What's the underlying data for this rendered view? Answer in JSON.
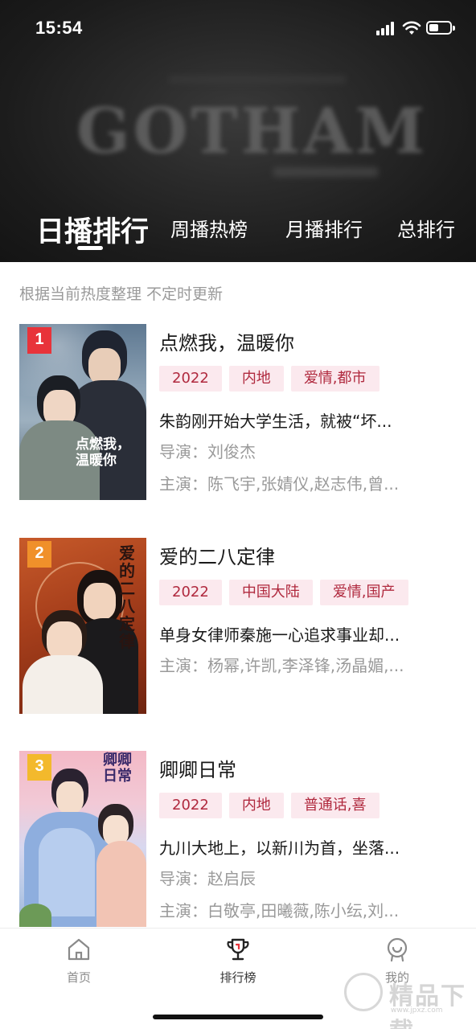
{
  "status_bar": {
    "time": "15:54",
    "battery_percent": 45
  },
  "header": {
    "backdrop_text": "GOTHAM",
    "tabs": [
      {
        "label": "日播排行",
        "active": true
      },
      {
        "label": "周播热榜",
        "active": false
      },
      {
        "label": "月播排行",
        "active": false
      },
      {
        "label": "总排行",
        "active": false
      }
    ]
  },
  "notice": "根据当前热度整理 不定时更新",
  "items": [
    {
      "rank": "1",
      "poster_text": "点燃我，温暖你",
      "title": "点燃我，温暖你",
      "tags": [
        "2022",
        "内地",
        "爱情,都市"
      ],
      "description": "朱韵刚开始大学生活，就被“坏...",
      "director": "导演：刘俊杰",
      "cast": "主演：陈飞宇,张婧仪,赵志伟,曾..."
    },
    {
      "rank": "2",
      "poster_text": "爱的二八定律",
      "title": "爱的二八定律",
      "tags": [
        "2022",
        "中国大陆",
        "爱情,国产"
      ],
      "description": "单身女律师秦施一心追求事业却...",
      "cast": "主演：杨幂,许凯,李泽锋,汤晶媚,..."
    },
    {
      "rank": "3",
      "poster_text": "卿卿日常",
      "title": "卿卿日常",
      "tags": [
        "2022",
        "内地",
        "普通话,喜"
      ],
      "description": "九川大地上，以新川为首，坐落...",
      "director": "导演：赵启辰",
      "cast": "主演：白敬亭,田曦薇,陈小纭,刘..."
    }
  ],
  "bottom_nav": [
    {
      "label": "首页",
      "icon": "home-icon",
      "active": false
    },
    {
      "label": "排行榜",
      "icon": "trophy-icon",
      "active": true
    },
    {
      "label": "我的",
      "icon": "profile-icon",
      "active": false
    }
  ],
  "watermark": {
    "text": "精品下载",
    "url": "www.jpxz.com"
  },
  "colors": {
    "tag_bg": "#fbe9ee",
    "tag_text": "#b0293e",
    "rank1": "#e8333a",
    "rank2": "#f0902a",
    "rank3": "#f3b92c"
  }
}
